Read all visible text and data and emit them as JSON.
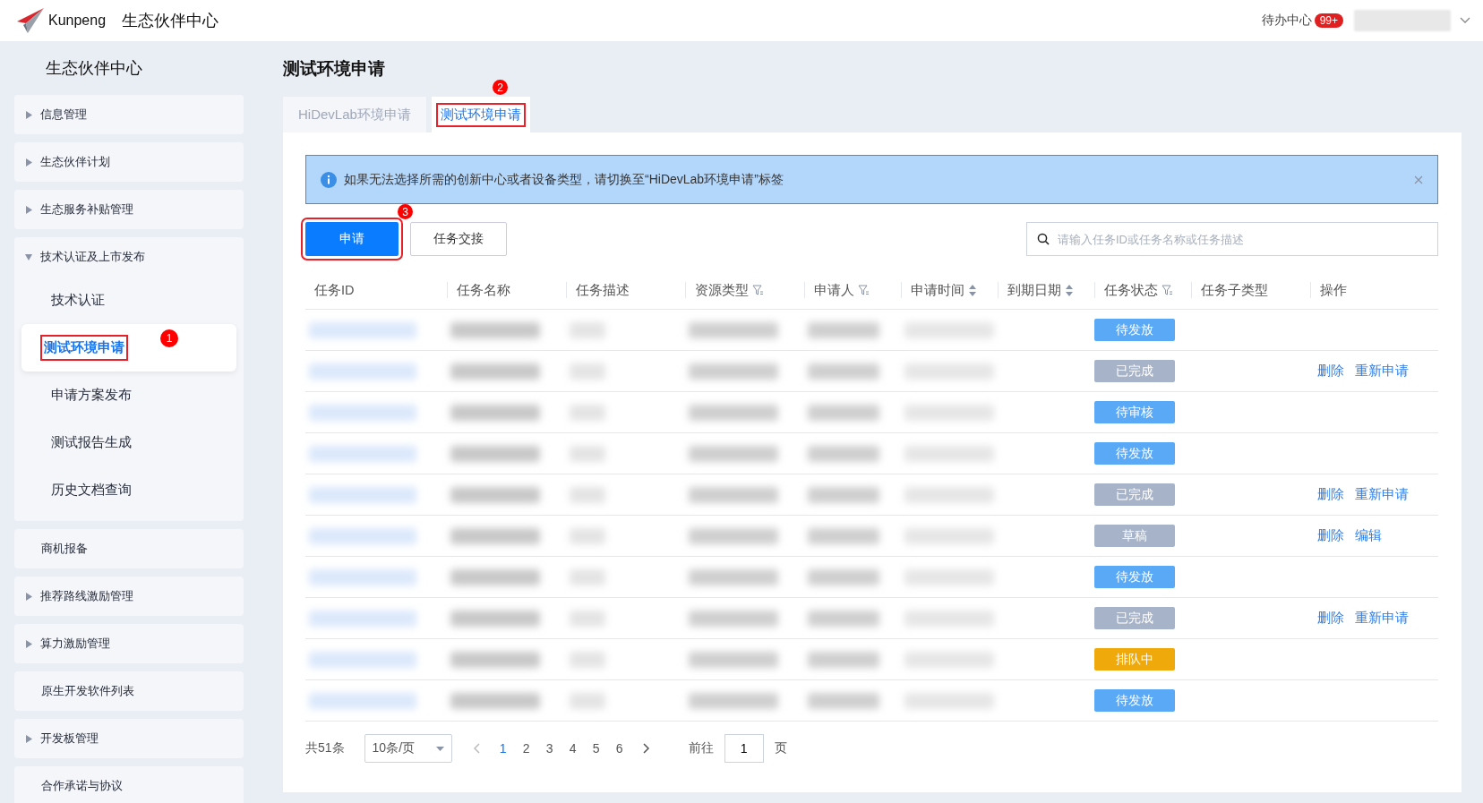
{
  "header": {
    "logo_text": "Kunpeng",
    "app_title": "生态伙伴中心",
    "todo_label": "待办中心",
    "todo_badge": "99+"
  },
  "sidebar": {
    "title": "生态伙伴中心",
    "items": [
      {
        "kind": "group",
        "label": "信息管理",
        "expanded": false
      },
      {
        "kind": "group",
        "label": "生态伙伴计划",
        "expanded": false
      },
      {
        "kind": "group",
        "label": "生态服务补贴管理",
        "expanded": false
      },
      {
        "kind": "group",
        "label": "技术认证及上市发布",
        "expanded": true,
        "children": [
          {
            "label": "技术认证",
            "selected": false
          },
          {
            "label": "测试环境申请",
            "selected": true,
            "callout": "1"
          },
          {
            "label": "申请方案发布",
            "selected": false
          },
          {
            "label": "测试报告生成",
            "selected": false
          },
          {
            "label": "历史文档查询",
            "selected": false
          }
        ]
      },
      {
        "kind": "link",
        "label": "商机报备"
      },
      {
        "kind": "group",
        "label": "推荐路线激励管理",
        "expanded": false
      },
      {
        "kind": "group",
        "label": "算力激励管理",
        "expanded": false
      },
      {
        "kind": "link",
        "label": "原生开发软件列表"
      },
      {
        "kind": "group",
        "label": "开发板管理",
        "expanded": false
      },
      {
        "kind": "link",
        "label": "合作承诺与协议"
      }
    ]
  },
  "page_title": "测试环境申请",
  "tabs": [
    {
      "label": "HiDevLab环境申请",
      "selected": false
    },
    {
      "label": "测试环境申请",
      "selected": true,
      "callout": "2"
    }
  ],
  "alert": {
    "text": "如果无法选择所需的创新中心或者设备类型，请切换至“HiDevLab环境申请”标签"
  },
  "buttons": [
    {
      "label": "申请",
      "kind": "primary",
      "callout": "3"
    },
    {
      "label": "任务交接",
      "kind": "default"
    }
  ],
  "search": {
    "placeholder": "请输入任务ID或任务名称或任务描述"
  },
  "table": {
    "columns": [
      {
        "label": "任务ID",
        "kind": "plain"
      },
      {
        "label": "任务名称",
        "kind": "plain"
      },
      {
        "label": "任务描述",
        "kind": "plain"
      },
      {
        "label": "资源类型",
        "kind": "filter"
      },
      {
        "label": "申请人",
        "kind": "filter"
      },
      {
        "label": "申请时间",
        "kind": "sort"
      },
      {
        "label": "到期日期",
        "kind": "sort"
      },
      {
        "label": "任务状态",
        "kind": "filter"
      },
      {
        "label": "任务子类型",
        "kind": "plain"
      },
      {
        "label": "操作",
        "kind": "plain"
      }
    ],
    "rows": [
      {
        "status": "待发放",
        "color": "#5aa9f7",
        "actions": []
      },
      {
        "status": "已完成",
        "color": "#a6b3c8",
        "actions": [
          "删除",
          "重新申请"
        ]
      },
      {
        "status": "待审核",
        "color": "#5aa9f7",
        "actions": []
      },
      {
        "status": "待发放",
        "color": "#5aa9f7",
        "actions": []
      },
      {
        "status": "已完成",
        "color": "#a6b3c8",
        "actions": [
          "删除",
          "重新申请"
        ]
      },
      {
        "status": "草稿",
        "color": "#a6b3c8",
        "actions": [
          "删除",
          "编辑"
        ]
      },
      {
        "status": "待发放",
        "color": "#5aa9f7",
        "actions": []
      },
      {
        "status": "已完成",
        "color": "#a6b3c8",
        "actions": [
          "删除",
          "重新申请"
        ]
      },
      {
        "status": "排队中",
        "color": "#f0a90a",
        "actions": []
      },
      {
        "status": "待发放",
        "color": "#5aa9f7",
        "actions": []
      }
    ]
  },
  "pagination": {
    "total": "共51条",
    "page_size": "10条/页",
    "pages": [
      {
        "label": "1",
        "selected": true
      },
      {
        "label": "2",
        "selected": false
      },
      {
        "label": "3",
        "selected": false
      },
      {
        "label": "4",
        "selected": false
      },
      {
        "label": "5",
        "selected": false
      },
      {
        "label": "6",
        "selected": false
      }
    ],
    "goto_label": "前往",
    "goto_value": "1",
    "page_unit": "页"
  }
}
